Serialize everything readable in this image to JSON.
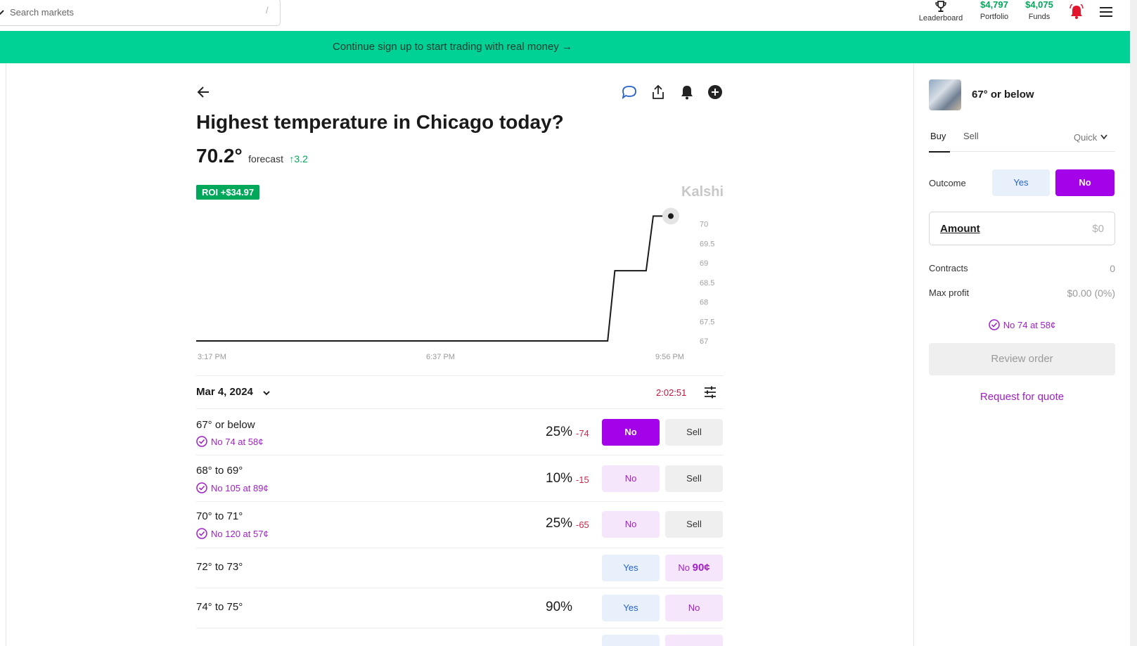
{
  "search": {
    "placeholder": "Search markets",
    "shortcut": "/"
  },
  "nav": {
    "leaderboard_label": "Leaderboard",
    "portfolio_value": "$4,797",
    "portfolio_label": "Portfolio",
    "funds_value": "$4,075",
    "funds_label": "Funds"
  },
  "banner": {
    "text": "Continue sign up to start trading with real money →"
  },
  "market": {
    "title": "Highest temperature in Chicago today?",
    "forecast_value": "70.2°",
    "forecast_label": "forecast",
    "forecast_change": "↑3.2",
    "roi_badge": "ROI +$34.97",
    "watermark": "Kalshi"
  },
  "chart_data": {
    "type": "line",
    "title": "",
    "xlabel": "",
    "ylabel": "",
    "x_tick_labels": [
      "3:17 PM",
      "6:37 PM",
      "9:56 PM"
    ],
    "y_ticks": [
      67,
      67.5,
      68,
      68.5,
      69,
      69.5,
      70
    ],
    "ylim": [
      67,
      70.3
    ],
    "line_style": "step",
    "grid": false,
    "series": [
      {
        "x_frac": [
          0,
          0.867,
          0.882,
          0.948,
          0.963,
          1.0
        ],
        "values": [
          67,
          67,
          68.8,
          68.8,
          70.2,
          70.2
        ]
      }
    ],
    "color": "#1a1a1a"
  },
  "date_bar": {
    "date": "Mar 4, 2024",
    "timer": "2:02:51"
  },
  "rows": [
    {
      "name": "67° or below",
      "position": "No 74 at 58¢",
      "pct": "25%",
      "change": "-74",
      "btn1": "No",
      "btn2": "Sell"
    },
    {
      "name": "68° to 69°",
      "position": "No 105 at 89¢",
      "pct": "10%",
      "change": "-15",
      "btn1": "No",
      "btn2": "Sell"
    },
    {
      "name": "70° to 71°",
      "position": "No 120 at 57¢",
      "pct": "25%",
      "change": "-65",
      "btn1": "No",
      "btn2": "Sell"
    },
    {
      "name": "72° to 73°",
      "btn1": "Yes",
      "btn2_prefix": "No",
      "btn2_price": "90¢"
    },
    {
      "name": "74° to 75°",
      "pct": "90%",
      "btn1": "Yes",
      "btn2": "No"
    }
  ],
  "panel": {
    "contract_title": "67° or below",
    "tab_buy": "Buy",
    "tab_sell": "Sell",
    "mode": "Quick",
    "outcome_label": "Outcome",
    "outcome_yes": "Yes",
    "outcome_no": "No",
    "amount_label": "Amount",
    "amount_value": "$0",
    "contracts_label": "Contracts",
    "contracts_value": "0",
    "max_profit_label": "Max profit",
    "max_profit_value": "$0.00 (0%)",
    "position": "No 74 at 58¢",
    "review_button": "Review order",
    "rfq_link": "Request for quote"
  },
  "colors": {
    "brand_green": "#00d296",
    "purple": "#a402e8",
    "positive": "#00a85a",
    "negative": "#d0294a"
  }
}
